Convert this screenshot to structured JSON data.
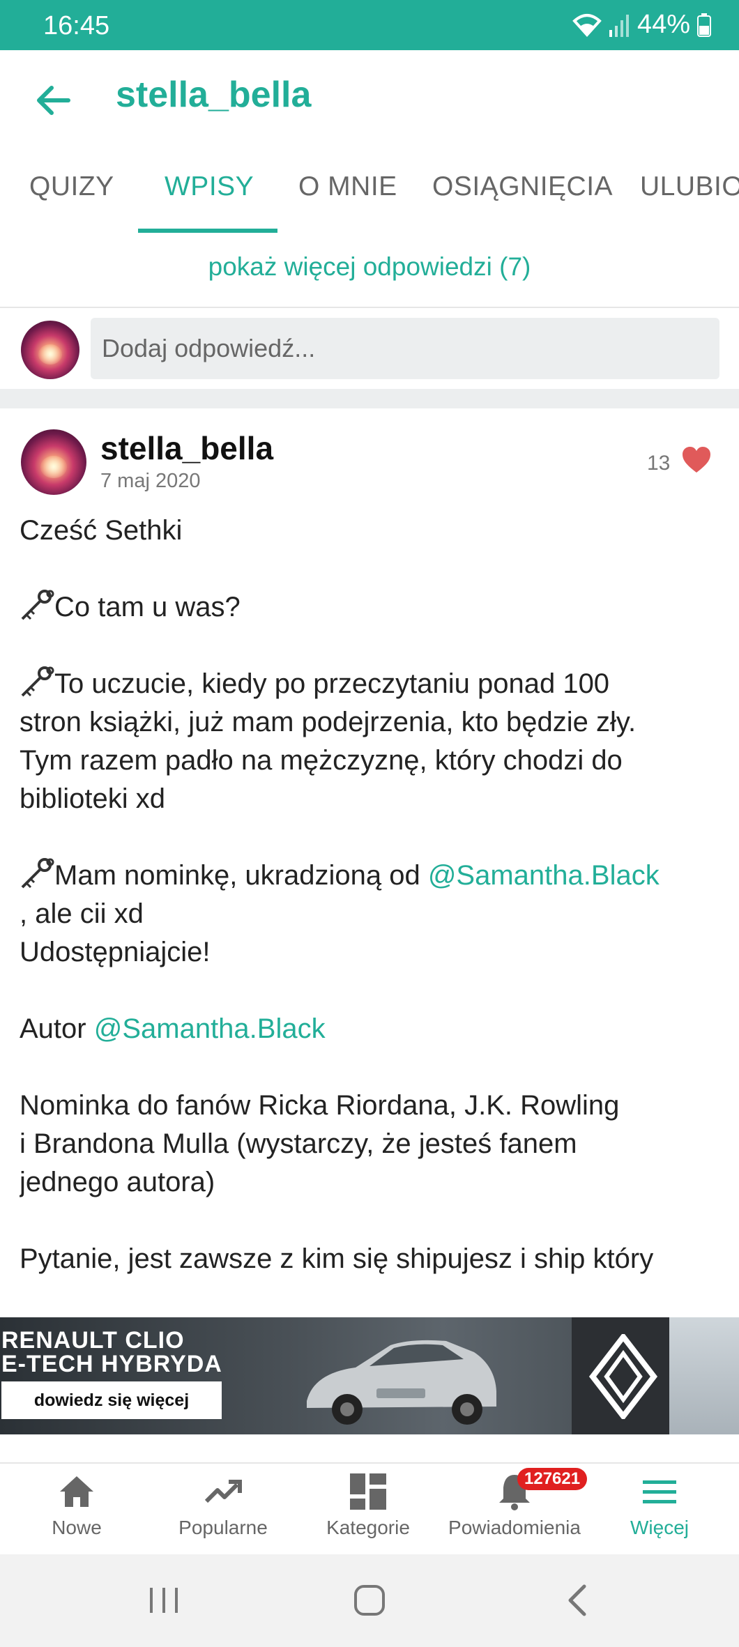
{
  "status_bar": {
    "time": "16:45",
    "battery": "44%"
  },
  "header": {
    "title": "stella_bella"
  },
  "tabs": [
    {
      "label": "QUIZY"
    },
    {
      "label": "WPISY"
    },
    {
      "label": "O MNIE"
    },
    {
      "label": "OSIĄGNIĘCIA"
    },
    {
      "label": "ULUBIO"
    }
  ],
  "replies": {
    "more_label": "pokaż więcej odpowiedzi (7)",
    "input_placeholder": "Dodaj odpowiedź..."
  },
  "post": {
    "author": "stella_bella",
    "date": "7 maj 2020",
    "likes": "13",
    "greeting": "Cześć Sethki",
    "p1": "Co tam u was?",
    "p2_a": "To uczucie, kiedy po przeczytaniu ponad 100",
    "p2_b": "stron książki, już mam podejrzenia, kto będzie zły.",
    "p2_c": "Tym razem padło na mężczyznę, który chodzi do",
    "p2_d": "biblioteki xd",
    "p3_a": "Mam nominkę, ukradzioną od ",
    "p3_mention": "@Samantha.Black",
    "p3_b": ", ale cii xd",
    "p3_c": "Udostępniajcie!",
    "author_label": "Autor ",
    "author_mention": "@Samantha.Black",
    "p4_a": "Nominka do fanów Ricka Riordana, J.K. Rowling",
    "p4_b": "i Brandona Mulla (wystarczy, że jesteś fanem",
    "p4_c": "jednego autora)",
    "p5_a": "Pytanie, jest zawsze z kim się shipujesz i ship który"
  },
  "ad": {
    "line1": "RENAULT CLIO",
    "line2": "E-TECH HYBRYDA",
    "cta": "dowiedz się więcej"
  },
  "bottom_nav": {
    "items": [
      {
        "label": "Nowe",
        "icon": "home-icon"
      },
      {
        "label": "Popularne",
        "icon": "trending-icon"
      },
      {
        "label": "Kategorie",
        "icon": "grid-icon"
      },
      {
        "label": "Powiadomienia",
        "icon": "bell-icon"
      },
      {
        "label": "Więcej",
        "icon": "menu-icon"
      }
    ],
    "notification_count": "127621"
  },
  "colors": {
    "accent": "#22ae98",
    "heart": "#e05a5a",
    "badge": "#e02020"
  }
}
